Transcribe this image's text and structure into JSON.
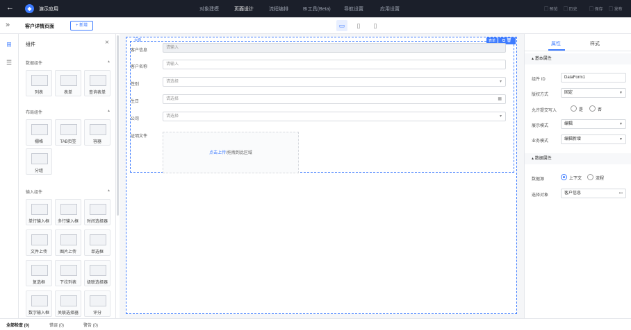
{
  "topbar": {
    "app_name": "演示应用",
    "nav": [
      "对象建模",
      "页面设计",
      "流程编排",
      "BI工具(Beta)",
      "导航设置",
      "应用设置"
    ],
    "actions": [
      "预览",
      "历史",
      "保存",
      "发布"
    ]
  },
  "subbar": {
    "page_title": "客户详情页面",
    "new_button": "+ 新增"
  },
  "panel": {
    "title": "组件",
    "groups": [
      {
        "title": "数据组件",
        "items": [
          "列表",
          "表单",
          "查询表单"
        ]
      },
      {
        "title": "布局组件",
        "items": [
          "栅格",
          "TAB页签",
          "容器",
          "分组"
        ]
      },
      {
        "title": "输入组件",
        "items": [
          "单行输入框",
          "多行输入框",
          "时间选择器",
          "文件上传",
          "图片上传",
          "单选框",
          "复选框",
          "下拉列表",
          "级联选择器",
          "数字输入框",
          "关联选择器",
          "评分"
        ]
      }
    ]
  },
  "canvas": {
    "form_tag_outer": "页面",
    "selected_tag": "表单",
    "fields": [
      {
        "label": "客户信息",
        "placeholder": "请输入",
        "suffix": ""
      },
      {
        "label": "客户名称",
        "placeholder": "请输入",
        "suffix": ""
      },
      {
        "label": "性别",
        "placeholder": "请选择",
        "suffix": "▾"
      },
      {
        "label": "生日",
        "placeholder": "请选择",
        "suffix": "▦"
      },
      {
        "label": "公司",
        "placeholder": "请选择",
        "suffix": "▾"
      }
    ],
    "attachment_label": "证明文件",
    "upload_link": "点击上传",
    "upload_text": "/拖拽到此区域"
  },
  "rightpanel": {
    "tabs": [
      "属性",
      "样式"
    ],
    "basic_section": "基本属性",
    "props": [
      {
        "label": "组件 ID",
        "value": "DataForm1",
        "dropdown": false
      },
      {
        "label": "版权方式",
        "value": "固定",
        "dropdown": true
      },
      {
        "label": "允许提交写入",
        "value": "",
        "dropdown": false
      },
      {
        "label": "展示模式",
        "value": "编辑",
        "dropdown": true
      },
      {
        "label": "业务模式",
        "value": "编辑新增",
        "dropdown": true
      }
    ],
    "allow_options": [
      "是",
      "否"
    ],
    "data_section": "数据属性",
    "data_source_label": "数据源",
    "data_source_options": [
      "上下文",
      "流程"
    ],
    "select_object_label": "选择对象",
    "select_object_value": "客户信息",
    "more": "•••"
  },
  "bottombar": {
    "tabs": [
      "全部检查 (0)",
      "错误 (0)",
      "警告 (0)"
    ]
  }
}
